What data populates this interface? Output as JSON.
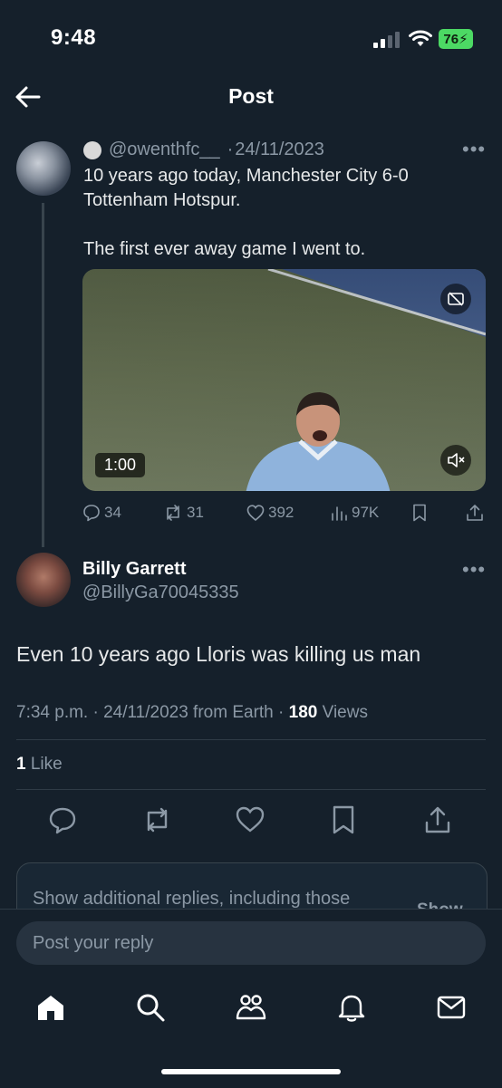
{
  "status_bar": {
    "time": "9:48",
    "battery": "76"
  },
  "header": {
    "title": "Post"
  },
  "original_post": {
    "handle": "@owenthfc__",
    "separator": "·",
    "date": "24/11/2023",
    "text": "10 years ago today, Manchester City 6-0 Tottenham Hotspur.\n\nThe first ever away game I went to.",
    "video_duration": "1:00",
    "stats": {
      "replies": "34",
      "reposts": "31",
      "likes": "392",
      "views": "97K"
    }
  },
  "reply_post": {
    "name": "Billy Garrett",
    "handle": "@BillyGa70045335",
    "text": "Even 10 years ago Lloris was killing us man",
    "time": "7:34 p.m. · 24/11/2023 from Earth · ",
    "views_count": "180",
    "views_label": " Views",
    "likes_count": "1",
    "likes_label": " Like"
  },
  "more_replies": {
    "text": "Show additional replies, including those",
    "show_label": "Show"
  },
  "composer": {
    "placeholder": "Post your reply"
  },
  "icons": {
    "back": "arrow-left-icon",
    "reply": "reply-icon",
    "repost": "repost-icon",
    "like": "heart-icon",
    "views": "views-icon",
    "bookmark": "bookmark-icon",
    "share": "share-icon",
    "home": "home-icon",
    "search": "search-icon",
    "communities": "communities-icon",
    "notifications": "bell-icon",
    "messages": "mail-icon"
  }
}
